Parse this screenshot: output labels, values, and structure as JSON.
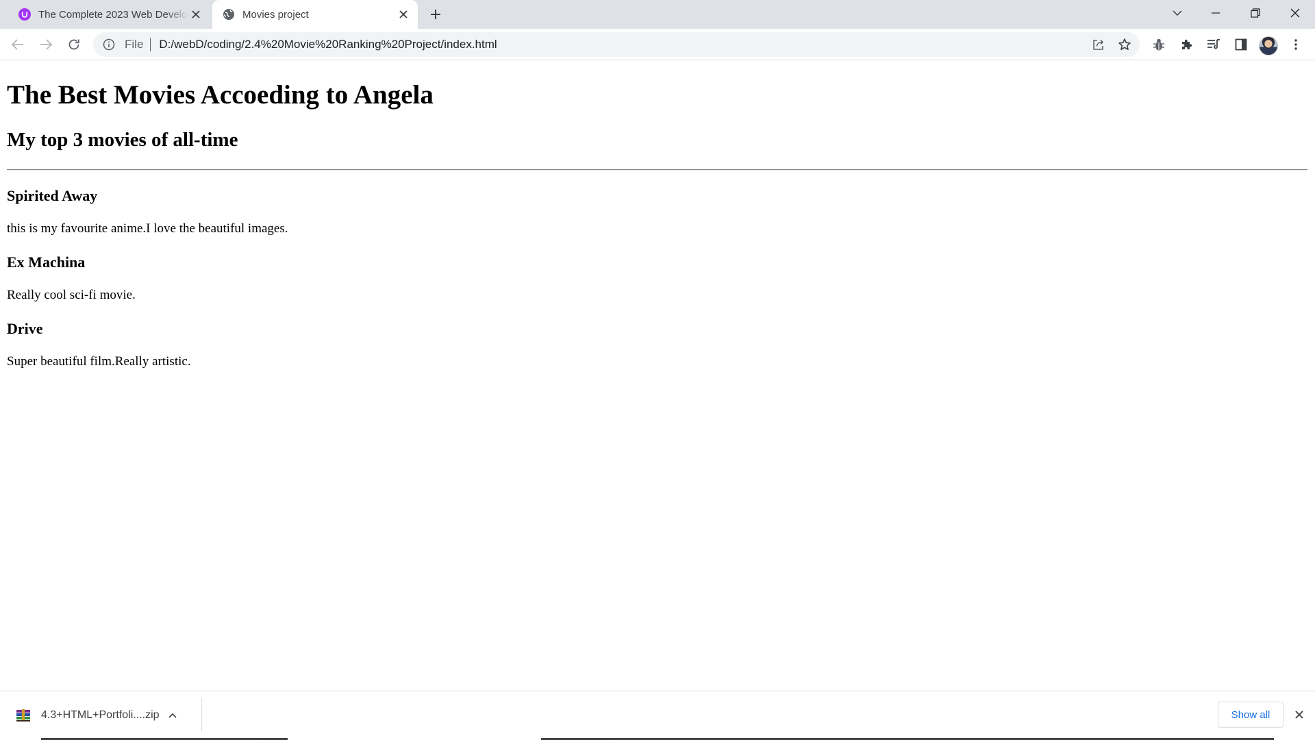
{
  "browser": {
    "tabs": [
      {
        "title": "The Complete 2023 Web Development Bootcamp",
        "favicon": "udemy-icon",
        "active": false
      },
      {
        "title": "Movies project",
        "favicon": "globe-icon",
        "active": true
      }
    ],
    "address_bar": {
      "scheme_label": "File",
      "url": "D:/webD/coding/2.4%20Movie%20Ranking%20Project/index.html"
    },
    "toolbar_icons": [
      "back-icon",
      "forward-icon",
      "reload-icon",
      "share-icon",
      "bookmark-star-icon",
      "bug-extension-icon",
      "extensions-puzzle-icon",
      "reading-list-icon",
      "side-panel-icon",
      "profile-avatar",
      "menu-kebab-icon"
    ],
    "window_controls": [
      "tab-search-chevron-icon",
      "minimize-icon",
      "restore-icon",
      "close-icon"
    ]
  },
  "page": {
    "heading": "The Best Movies Accoeding to Angela",
    "subheading": "My top 3 movies of all-time",
    "movies": [
      {
        "title": "Spirited Away",
        "description": "this is my favourite anime.I love the beautiful images."
      },
      {
        "title": "Ex Machina",
        "description": "Really cool sci-fi movie."
      },
      {
        "title": "Drive",
        "description": "Super beautiful film.Really artistic."
      }
    ]
  },
  "downloads": {
    "items": [
      {
        "filename": "4.3+HTML+Portfoli....zip",
        "icon": "winrar-archive-icon"
      }
    ],
    "show_all_label": "Show all"
  },
  "colors": {
    "tabstrip_bg": "#dee1e6",
    "omnibox_bg": "#f1f3f4",
    "link_blue": "#1a73e8",
    "udemy_purple": "#a435f0"
  }
}
